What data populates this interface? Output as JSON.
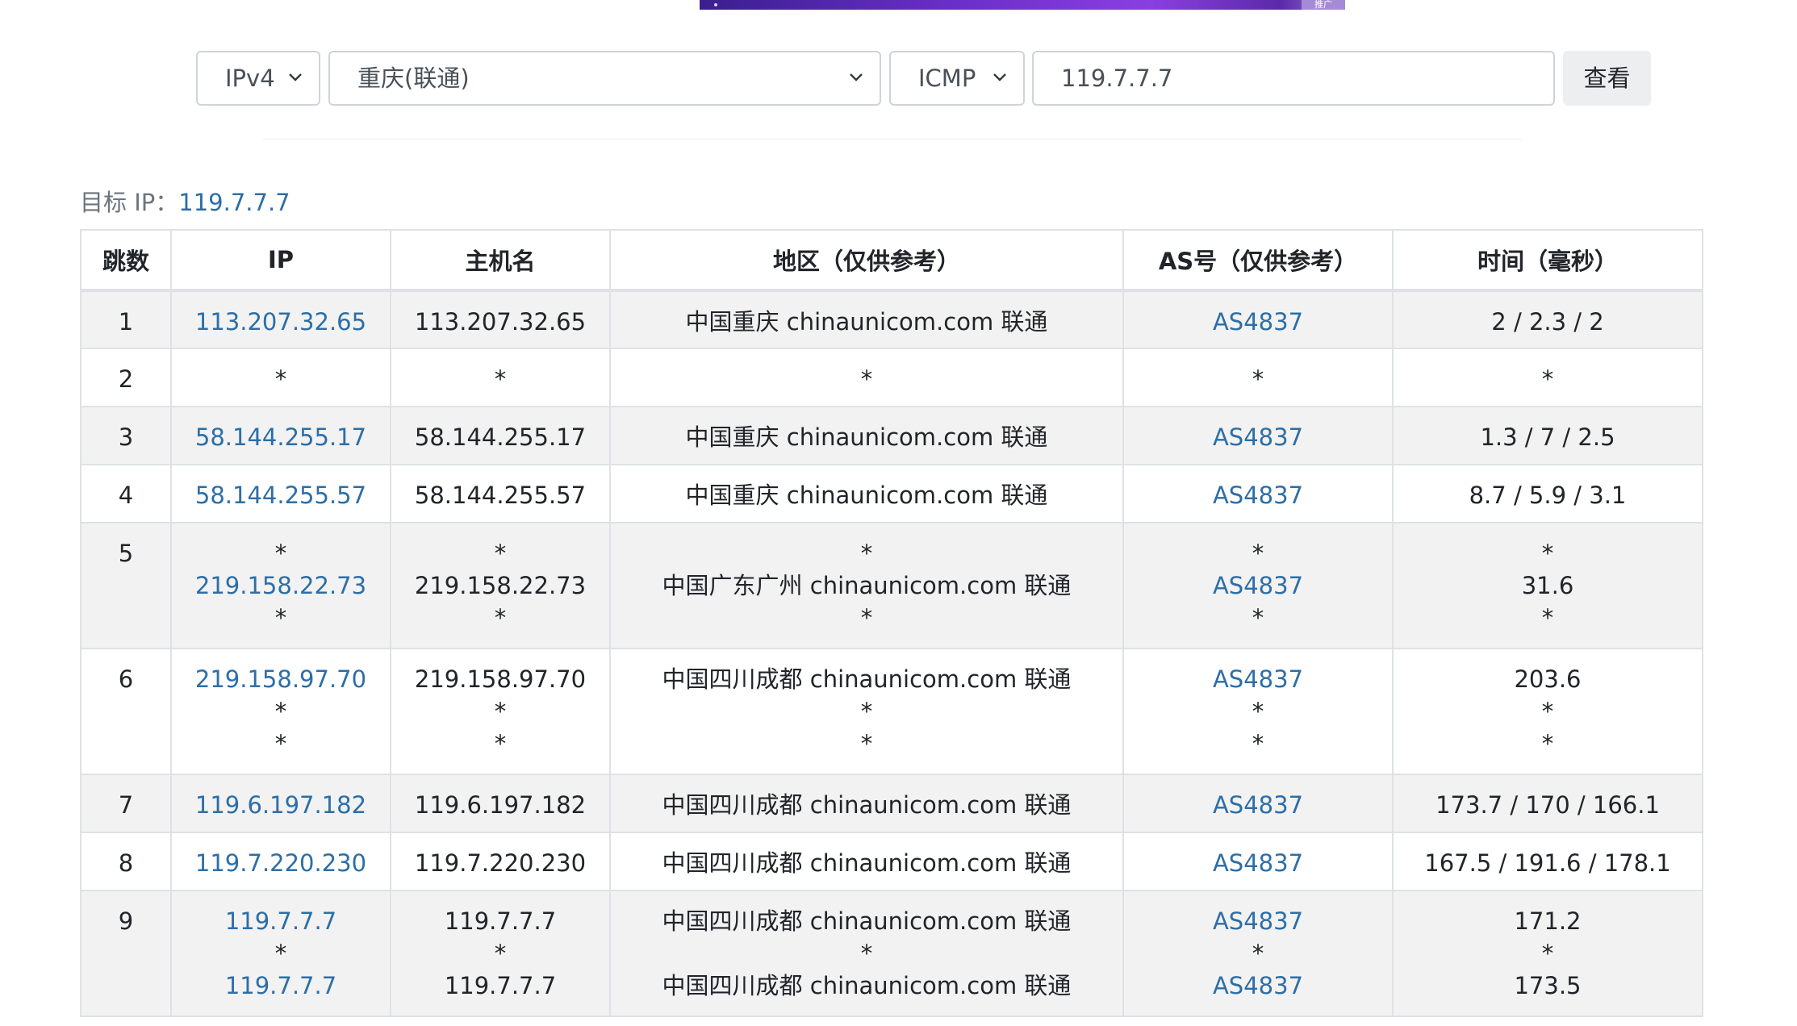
{
  "banner": {
    "tag": "推广"
  },
  "toolbar": {
    "ip_version": "IPv4",
    "node": "重庆(联通)",
    "protocol": "ICMP",
    "target_value": "119.7.7.7",
    "submit_label": "查看"
  },
  "target": {
    "label": "目标 IP：",
    "ip": "119.7.7.7"
  },
  "table": {
    "headers": [
      "跳数",
      "IP",
      "主机名",
      "地区（仅供参考）",
      "AS号（仅供参考）",
      "时间（毫秒）"
    ],
    "rows": [
      {
        "hop": "1",
        "ip": [
          "113.207.32.65"
        ],
        "host": [
          "113.207.32.65"
        ],
        "region": [
          "中国重庆 chinaunicom.com 联通"
        ],
        "as": [
          "AS4837"
        ],
        "time": [
          "2 / 2.3 / 2"
        ]
      },
      {
        "hop": "2",
        "ip": [
          "*"
        ],
        "host": [
          "*"
        ],
        "region": [
          "*"
        ],
        "as": [
          "*"
        ],
        "time": [
          "*"
        ]
      },
      {
        "hop": "3",
        "ip": [
          "58.144.255.17"
        ],
        "host": [
          "58.144.255.17"
        ],
        "region": [
          "中国重庆 chinaunicom.com 联通"
        ],
        "as": [
          "AS4837"
        ],
        "time": [
          "1.3 / 7 / 2.5"
        ]
      },
      {
        "hop": "4",
        "ip": [
          "58.144.255.57"
        ],
        "host": [
          "58.144.255.57"
        ],
        "region": [
          "中国重庆 chinaunicom.com 联通"
        ],
        "as": [
          "AS4837"
        ],
        "time": [
          "8.7 / 5.9 / 3.1"
        ]
      },
      {
        "hop": "5",
        "ip": [
          "*",
          "219.158.22.73",
          "*"
        ],
        "host": [
          "*",
          "219.158.22.73",
          "*"
        ],
        "region": [
          "*",
          "中国广东广州 chinaunicom.com 联通",
          "*"
        ],
        "as": [
          "*",
          "AS4837",
          "*"
        ],
        "time": [
          "*",
          "31.6",
          "*"
        ]
      },
      {
        "hop": "6",
        "ip": [
          "219.158.97.70",
          "*",
          "*"
        ],
        "host": [
          "219.158.97.70",
          "*",
          "*"
        ],
        "region": [
          "中国四川成都 chinaunicom.com 联通",
          "*",
          "*"
        ],
        "as": [
          "AS4837",
          "*",
          "*"
        ],
        "time": [
          "203.6",
          "*",
          "*"
        ]
      },
      {
        "hop": "7",
        "ip": [
          "119.6.197.182"
        ],
        "host": [
          "119.6.197.182"
        ],
        "region": [
          "中国四川成都 chinaunicom.com 联通"
        ],
        "as": [
          "AS4837"
        ],
        "time": [
          "173.7 / 170 / 166.1"
        ]
      },
      {
        "hop": "8",
        "ip": [
          "119.7.220.230"
        ],
        "host": [
          "119.7.220.230"
        ],
        "region": [
          "中国四川成都 chinaunicom.com 联通"
        ],
        "as": [
          "AS4837"
        ],
        "time": [
          "167.5 / 191.6 / 178.1"
        ]
      },
      {
        "hop": "9",
        "ip": [
          "119.7.7.7",
          "*",
          "119.7.7.7"
        ],
        "host": [
          "119.7.7.7",
          "*",
          "119.7.7.7"
        ],
        "region": [
          "中国四川成都 chinaunicom.com 联通",
          "*",
          "中国四川成都 chinaunicom.com 联通"
        ],
        "as": [
          "AS4837",
          "*",
          "AS4837"
        ],
        "time": [
          "171.2",
          "*",
          "173.5"
        ]
      }
    ]
  }
}
